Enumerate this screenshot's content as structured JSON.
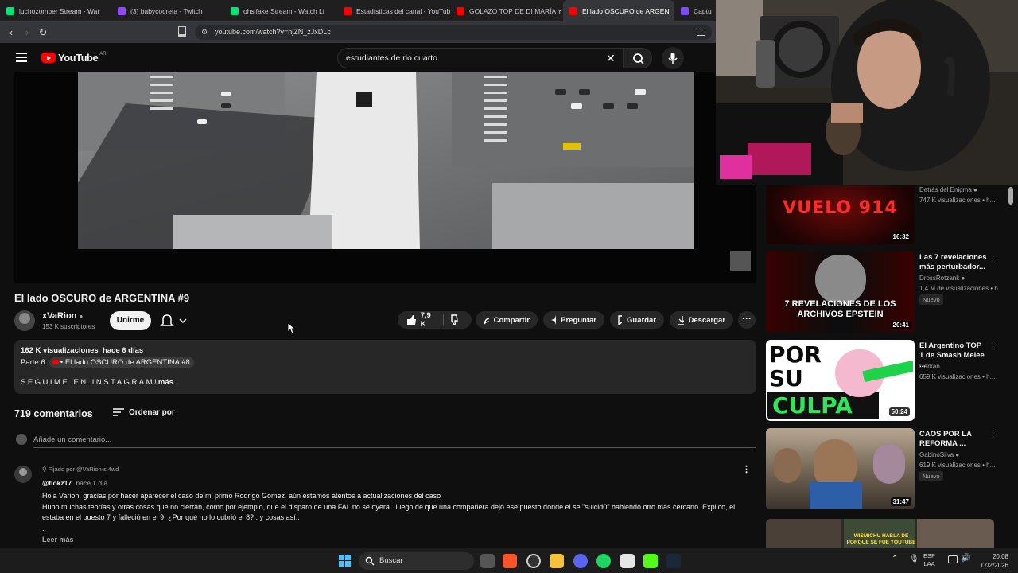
{
  "tabs": [
    {
      "label": "luchozomber Stream - Wat",
      "color": "#00e676"
    },
    {
      "label": "(3) babycocreta - Twitch",
      "color": "#9146ff"
    },
    {
      "label": "ohsifake Stream - Watch Li",
      "color": "#00e676"
    },
    {
      "label": "Estadísticas del canal - YouTub",
      "color": "#ff0000"
    },
    {
      "label": "GOLAZO TOP DE DI MARÍA Y",
      "color": "#ff0000"
    },
    {
      "label": "El lado OSCURO de ARGEN",
      "color": "#ff0000",
      "active": true
    },
    {
      "label": "Captu",
      "color": "#7c4dff"
    }
  ],
  "browser": {
    "url": "youtube.com/watch?v=njZN_zJxDLc"
  },
  "masthead": {
    "logo_text": "YouTube",
    "region": "AR",
    "search_value": "estudiantes de rio cuarto"
  },
  "video": {
    "title": "El lado OSCURO de ARGENTINA #9",
    "channel": "xVaRion",
    "subscribers": "153 K suscriptores",
    "join_label": "Unirme",
    "likes": "7,9 K",
    "share_label": "Compartir",
    "ask_label": "Preguntar",
    "save_label": "Guardar",
    "download_label": "Descargar"
  },
  "description": {
    "stats": "162 K visualizaciones  hace 6 días",
    "part_prefix": "Parte 6:",
    "part_link": "• El lado OSCURO de ARGENTINA #8",
    "text": "SEGUIME EN INSTAGRAM!",
    "more": "...más"
  },
  "comments": {
    "count_label": "719 comentarios",
    "sort_label": "Ordenar por",
    "add_placeholder": "Añade un comentario...",
    "pinned": "Fijado por @VaRion-sj4wd",
    "author": "@flokz17",
    "time": "hace 1 día",
    "line1": "Hola Varion, gracias por hacer aparecer el caso de mi primo Rodrigo Gomez, aún estamos atentos a actualizaciones del caso",
    "line2": "Hubo muchas teorías y otras cosas que no cierran, como por ejemplo, que el disparo de una FAL no se oyera.. luego de que una compañera dejó ese puesto donde el se \"suicid0\" habiendo otro más cercano. Explico, el",
    "line3": "estaba en el puesto 7 y falleció en el 9. ¿Por qué no lo cubrió el 8?.. y cosas así..",
    "line4": "..",
    "read_more": "Leer más"
  },
  "sidebar": [
    {
      "title": "",
      "channel": "Detrás del Enigma",
      "views": "747 K visualizaciones • h...",
      "duration": "16:32",
      "thumb_text": "VUELO 914",
      "badge": ""
    },
    {
      "title": "Las 7 revelaciones más perturbador...",
      "channel": "DrossRotzank",
      "views": "1,4 M de visualizaciones • h",
      "duration": "20:41",
      "thumb_text": "7 REVELACIONES DE LOS ARCHIVOS EPSTEIN",
      "badge": "Nuevo"
    },
    {
      "title": "El Argentino TOP 1 de Smash Melee ...",
      "channel": "Darkan",
      "views": "659 K visualizaciones • h...",
      "duration": "50:24",
      "thumb_text_1": "POR",
      "thumb_text_2": "SU",
      "thumb_text_3": "CULPA",
      "badge": ""
    },
    {
      "title": "CAOS POR LA REFORMA ...",
      "channel": "GabinoSilva",
      "views": "619 K visualizaciones • h...",
      "duration": "31:47",
      "badge": "Nuevo"
    },
    {
      "thumb_text": "WISMICHU HABLA DE PORQUE SE FUE YOUTUBE"
    }
  ],
  "taskbar": {
    "search_label": "Buscar",
    "lang_1": "ESP",
    "lang_2": "LAA",
    "time": "20:08",
    "date": "17/2/2026"
  },
  "colors": {
    "bg": "#0f0f0f",
    "accent_red": "#ff0000",
    "chip": "#272727"
  }
}
